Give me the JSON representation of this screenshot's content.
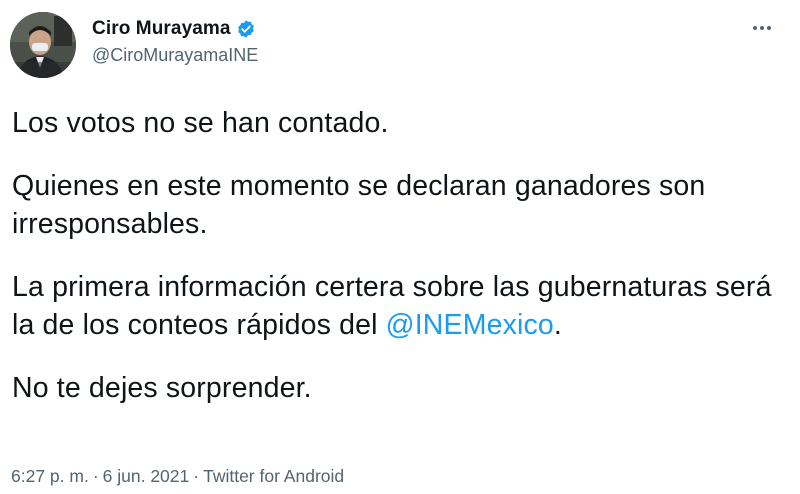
{
  "author": {
    "display_name": "Ciro Murayama",
    "handle": "@CiroMurayamaINE",
    "verified_icon": "verified-badge-icon",
    "avatar_icon": "avatar"
  },
  "menu": {
    "icon": "more-options-icon"
  },
  "tweet": {
    "line1": "Los votos no se han contado.",
    "line2": "Quienes en este momento se declaran ganadores son irresponsables.",
    "line3_prefix": "La primera información certera sobre las gubernaturas será la de los conteos rápidos del ",
    "mention": "@INEMexico",
    "line3_suffix": ".",
    "line4": "No te dejes sorprender."
  },
  "meta": {
    "time": "6:27 p. m.",
    "separator": "·",
    "date": "6 jun. 2021",
    "source": "Twitter for Android"
  },
  "colors": {
    "text": "#0f1419",
    "secondary": "#536471",
    "link": "#1d9bf0",
    "verified": "#1d9bf0"
  }
}
